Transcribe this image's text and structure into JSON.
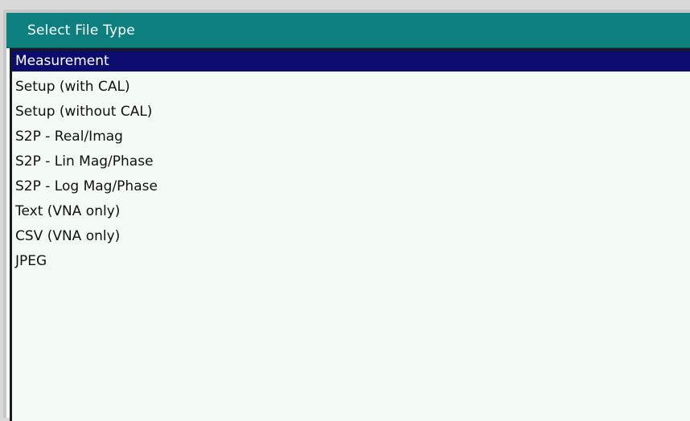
{
  "dialog": {
    "title": "Select File Type",
    "selected_index": 0,
    "colors": {
      "title_bar": "#0d7f7f",
      "selection": "#0c0c6e",
      "list_background": "#f4fbf4"
    },
    "items": [
      {
        "label": "Measurement"
      },
      {
        "label": "Setup (with CAL)"
      },
      {
        "label": "Setup (without CAL)"
      },
      {
        "label": "S2P - Real/Imag"
      },
      {
        "label": "S2P - Lin Mag/Phase"
      },
      {
        "label": "S2P - Log Mag/Phase"
      },
      {
        "label": "Text (VNA only)"
      },
      {
        "label": "CSV (VNA only)"
      },
      {
        "label": "JPEG"
      }
    ]
  }
}
